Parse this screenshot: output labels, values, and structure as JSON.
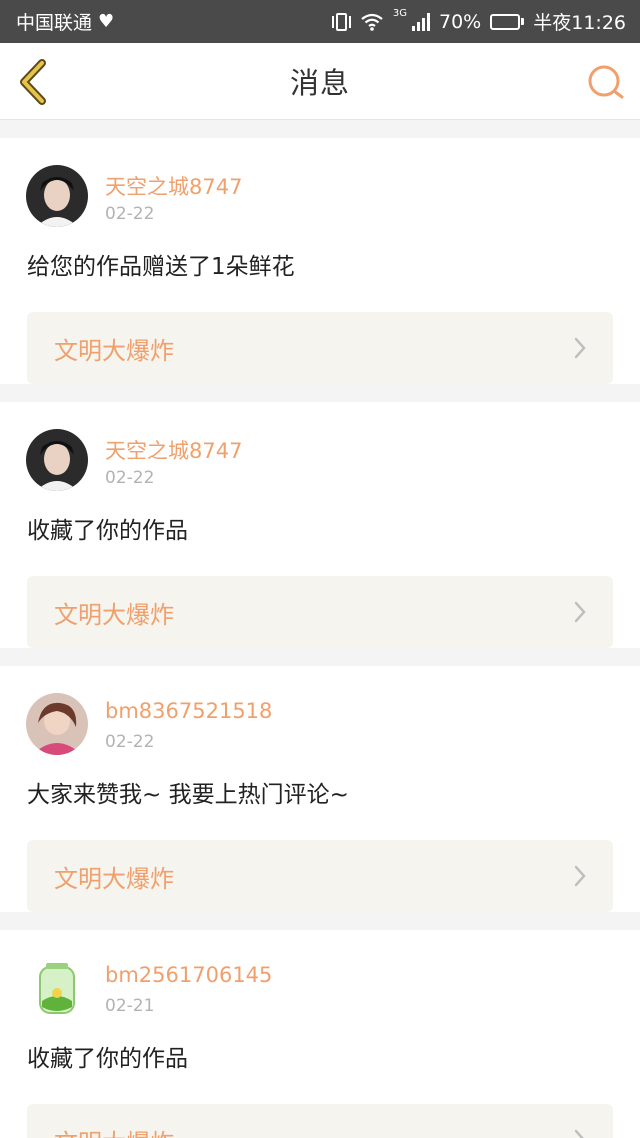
{
  "status_bar": {
    "carrier": "中国联通",
    "network": "3G",
    "battery": "70%",
    "battery_level": 0.7,
    "time": "半夜11:26"
  },
  "header": {
    "title": "消息",
    "back_icon": "chevron-left-icon",
    "search_icon": "search-icon"
  },
  "messages": [
    {
      "user": "天空之城8747",
      "date": "02-22",
      "text": "给您的作品赠送了1朵鲜花",
      "work": "文明大爆炸"
    },
    {
      "user": "天空之城8747",
      "date": "02-22",
      "text": "收藏了你的作品",
      "work": "文明大爆炸"
    },
    {
      "user": "bm8367521518",
      "date": "02-22",
      "text": "大家来赞我~ 我要上热门评论~",
      "work": "文明大爆炸"
    },
    {
      "user": "bm2561706145",
      "date": "02-21",
      "text": "收藏了你的作品",
      "work": "文明大爆炸"
    }
  ],
  "colors": {
    "accent": "#f0a06c",
    "back_arrow": "#e8c34a",
    "status_bar": "#4a4a4a",
    "link_bg": "#f5f4ee",
    "page_bg": "#f4f4f4"
  }
}
